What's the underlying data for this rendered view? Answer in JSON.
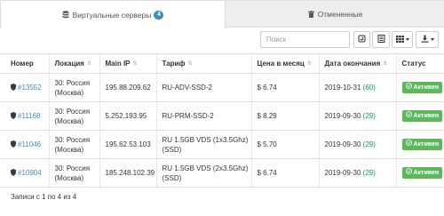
{
  "tabs": [
    {
      "label": "Виртуальные серверы",
      "badge": "4",
      "icon": "database-icon",
      "active": true
    },
    {
      "label": "Отмененные",
      "icon": "trash-icon",
      "active": false
    }
  ],
  "toolbar": {
    "search_placeholder": "Поиск",
    "buttons": [
      "refresh-icon",
      "list-view-icon",
      "grid-columns-icon",
      "export-icon"
    ]
  },
  "table": {
    "headers": [
      "Номер",
      "Локация",
      "Main IP",
      "Тариф",
      "Цена в месяц",
      "Дата окончания",
      "Статус"
    ],
    "rows": [
      {
        "number": "#13552",
        "location": "30: Россия (Москва)",
        "ip": "195.88.209.62",
        "tariff": "RU-ADV-SSD-2",
        "price": "$ 6.74",
        "date": "2019-10-31",
        "days": "(60)",
        "status": "Активен"
      },
      {
        "number": "#11168",
        "location": "30: Россия (Москва)",
        "ip": "5.252.193.95",
        "tariff": "RU-PRM-SSD-2",
        "price": "$ 8.29",
        "date": "2019-09-30",
        "days": "(29)",
        "status": "Активен"
      },
      {
        "number": "#11046",
        "location": "30: Россия (Москва)",
        "ip": "195.62.53.103",
        "tariff": "RU 1.5GB VDS (1x3.5Ghz) (SSD)",
        "price": "$ 5.70",
        "date": "2019-09-30",
        "days": "(29)",
        "status": "Активен"
      },
      {
        "number": "#10904",
        "location": "30: Россия (Москва)",
        "ip": "185.248.102.39",
        "tariff": "RU 1.5GB VDS (2x3.5Ghz) (SSD)",
        "price": "$ 6.74",
        "date": "2019-09-30",
        "days": "(29)",
        "status": "Активен"
      }
    ]
  },
  "footer": {
    "text": "Записи с 1 по 4 из 4"
  },
  "colors": {
    "accent": "#3c8dbc",
    "status_active": "#5cb85c",
    "days_remaining": "#00a65a"
  }
}
